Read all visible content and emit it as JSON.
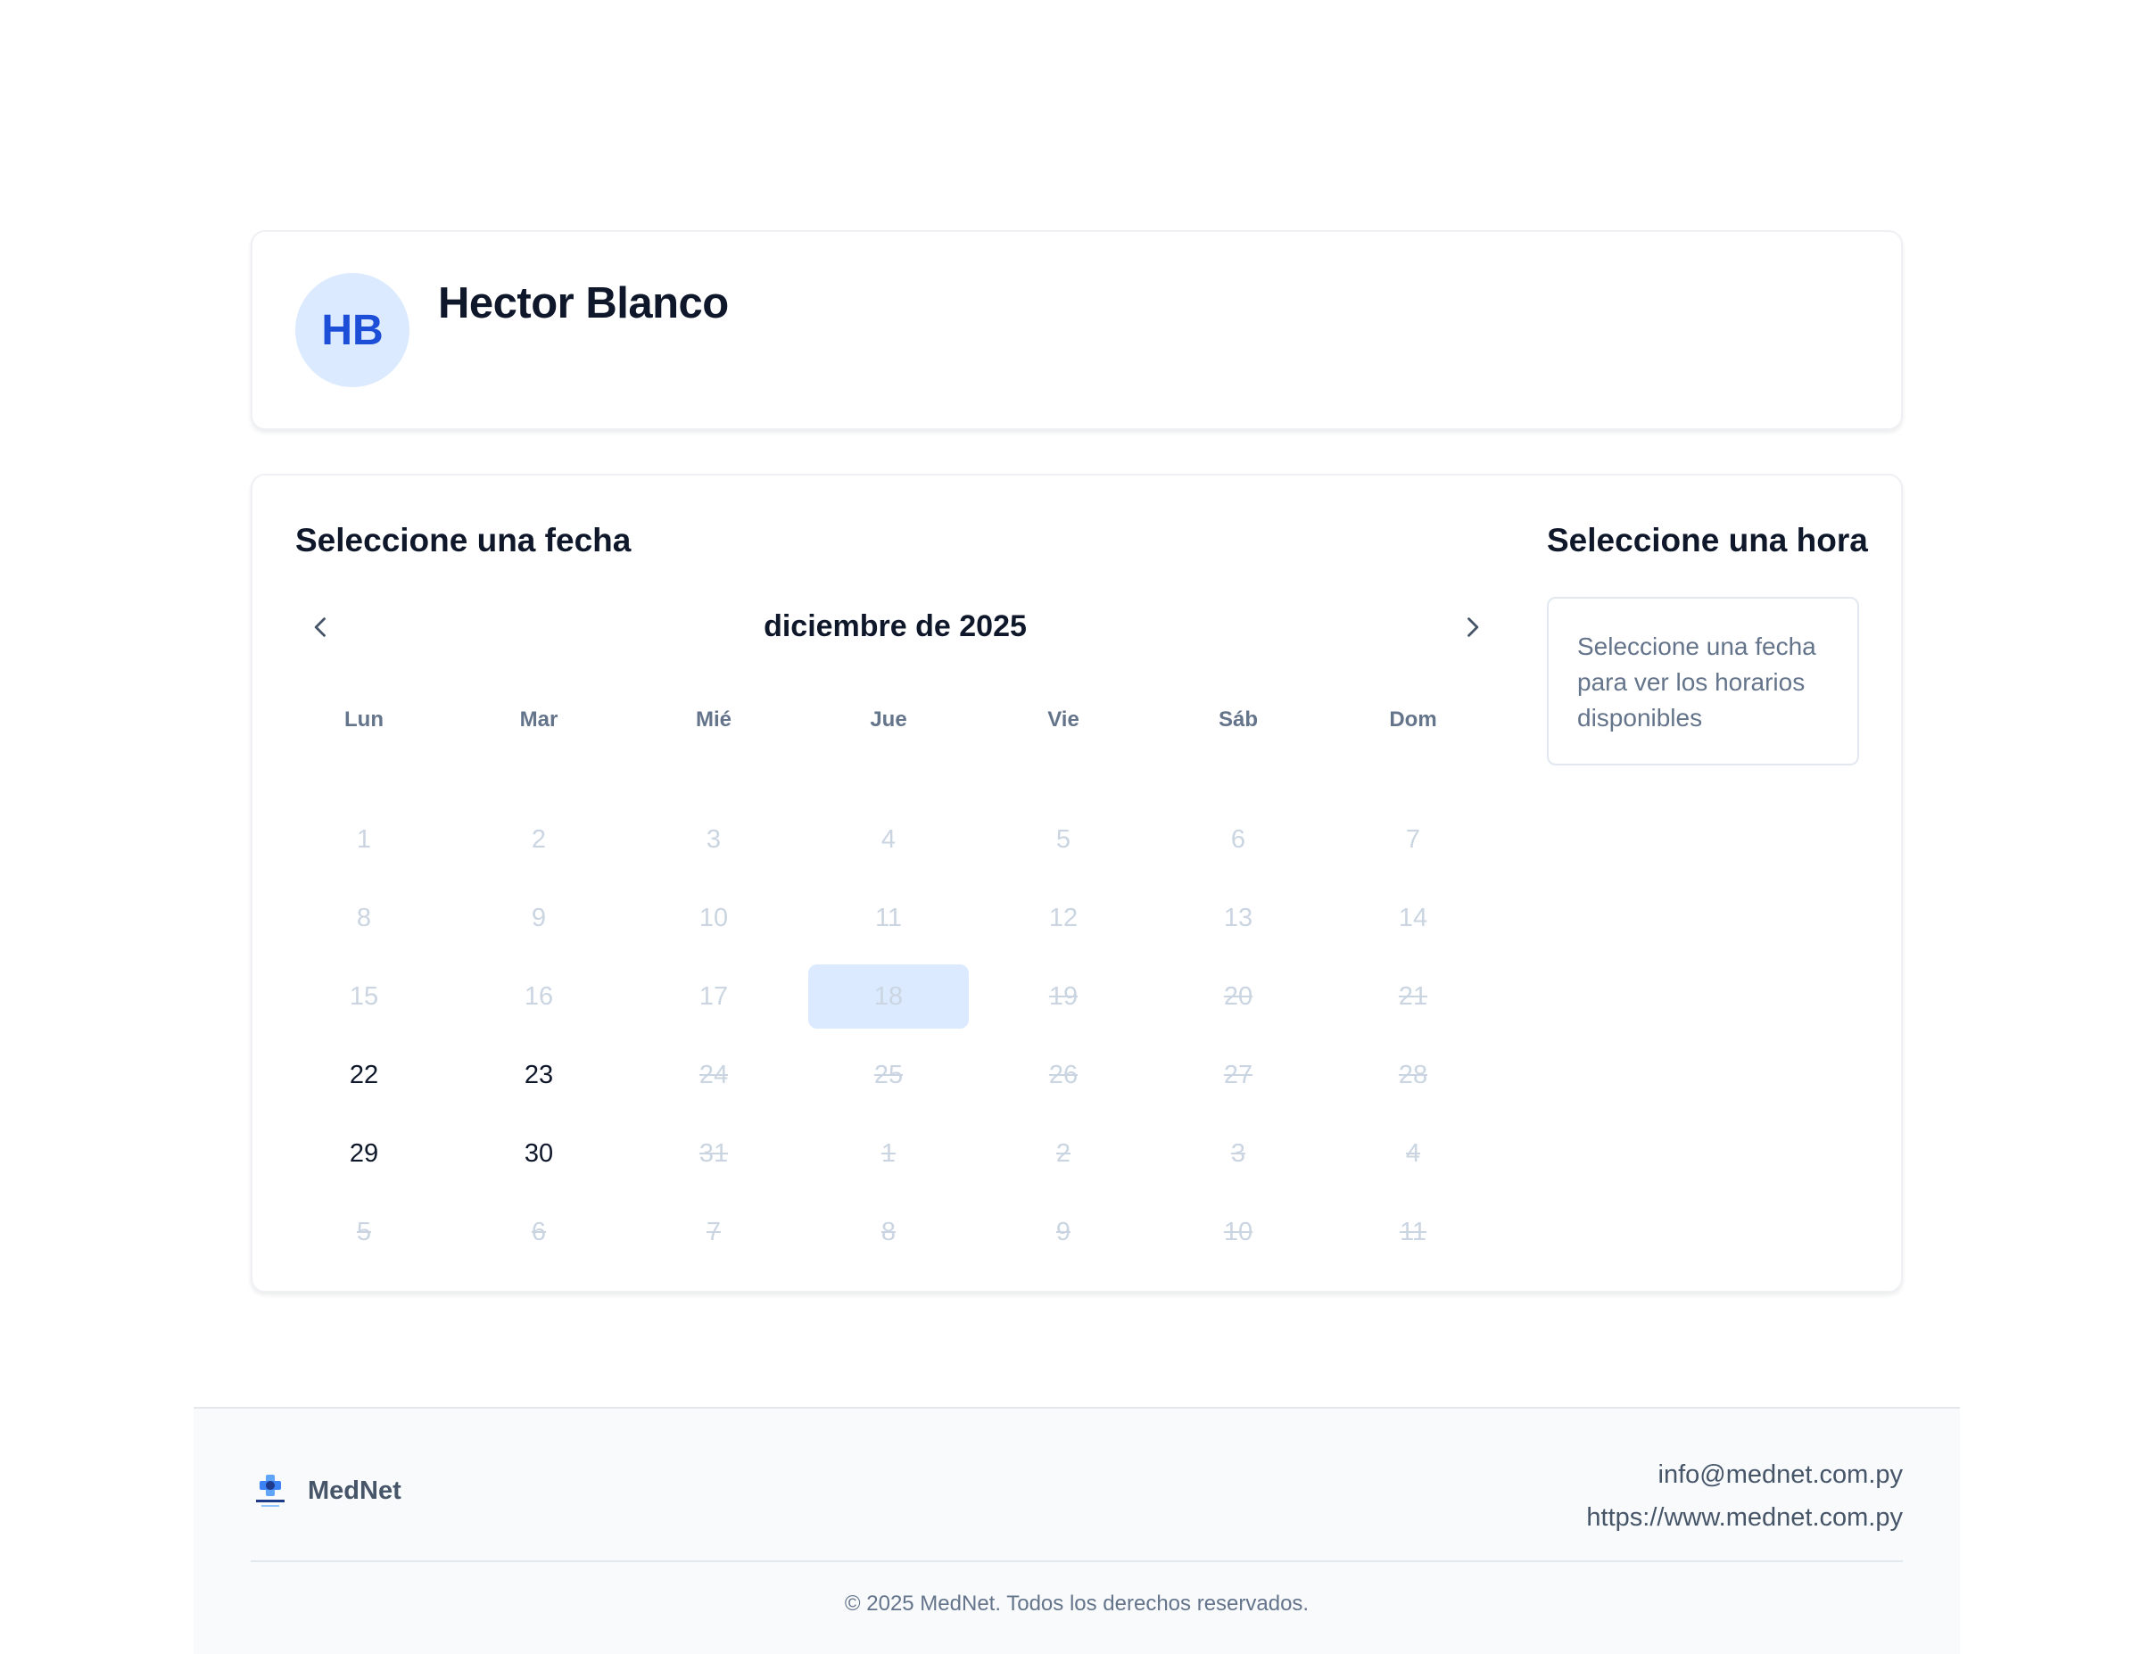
{
  "profile": {
    "initials": "HB",
    "name": "Hector Blanco"
  },
  "booking": {
    "date_title": "Seleccione una fecha",
    "time_title": "Seleccione una hora",
    "month_label": "diciembre de 2025",
    "weekdays": [
      "Lun",
      "Mar",
      "Mié",
      "Jue",
      "Vie",
      "Sáb",
      "Dom"
    ],
    "days": [
      {
        "label": "1",
        "state": "past"
      },
      {
        "label": "2",
        "state": "past"
      },
      {
        "label": "3",
        "state": "past"
      },
      {
        "label": "4",
        "state": "past"
      },
      {
        "label": "5",
        "state": "past"
      },
      {
        "label": "6",
        "state": "past"
      },
      {
        "label": "7",
        "state": "past"
      },
      {
        "label": "8",
        "state": "past"
      },
      {
        "label": "9",
        "state": "past"
      },
      {
        "label": "10",
        "state": "past"
      },
      {
        "label": "11",
        "state": "past"
      },
      {
        "label": "12",
        "state": "past"
      },
      {
        "label": "13",
        "state": "past"
      },
      {
        "label": "14",
        "state": "past"
      },
      {
        "label": "15",
        "state": "past"
      },
      {
        "label": "16",
        "state": "past"
      },
      {
        "label": "17",
        "state": "past"
      },
      {
        "label": "18",
        "state": "today"
      },
      {
        "label": "19",
        "state": "unavailable"
      },
      {
        "label": "20",
        "state": "unavailable"
      },
      {
        "label": "21",
        "state": "unavailable"
      },
      {
        "label": "22",
        "state": "available"
      },
      {
        "label": "23",
        "state": "available"
      },
      {
        "label": "24",
        "state": "unavailable"
      },
      {
        "label": "25",
        "state": "unavailable"
      },
      {
        "label": "26",
        "state": "unavailable"
      },
      {
        "label": "27",
        "state": "unavailable"
      },
      {
        "label": "28",
        "state": "unavailable"
      },
      {
        "label": "29",
        "state": "available"
      },
      {
        "label": "30",
        "state": "available"
      },
      {
        "label": "31",
        "state": "unavailable"
      },
      {
        "label": "1",
        "state": "unavailable"
      },
      {
        "label": "2",
        "state": "unavailable"
      },
      {
        "label": "3",
        "state": "unavailable"
      },
      {
        "label": "4",
        "state": "unavailable"
      },
      {
        "label": "5",
        "state": "unavailable"
      },
      {
        "label": "6",
        "state": "unavailable"
      },
      {
        "label": "7",
        "state": "unavailable"
      },
      {
        "label": "8",
        "state": "unavailable"
      },
      {
        "label": "9",
        "state": "unavailable"
      },
      {
        "label": "10",
        "state": "unavailable"
      },
      {
        "label": "11",
        "state": "unavailable"
      }
    ],
    "time_placeholder": "Seleccione una fecha para ver los horarios disponibles"
  },
  "footer": {
    "brand": "MedNet",
    "email": "info@mednet.com.py",
    "website": "https://www.mednet.com.py",
    "copyright": "© 2025 MedNet. Todos los derechos reservados."
  },
  "icons": {
    "prev": "chevron-left-icon",
    "next": "chevron-right-icon",
    "logo": "mednet-logo"
  },
  "colors": {
    "accent": "#1d4ed8",
    "accent_light": "#dbeafe",
    "text": "#0f172a",
    "muted": "#64748b",
    "disabled": "#cbd5e1"
  }
}
